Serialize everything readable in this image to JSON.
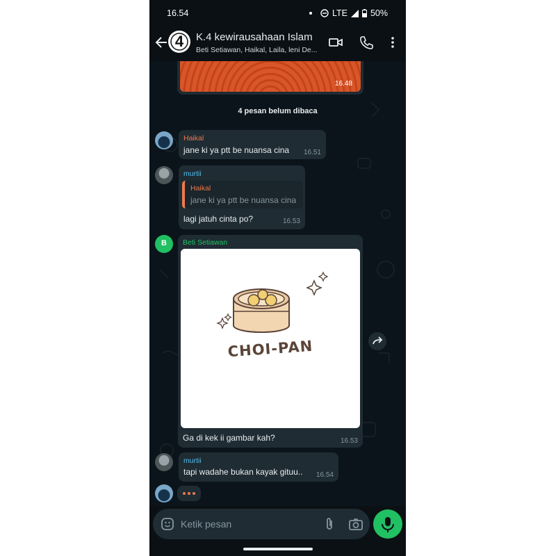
{
  "status_bar": {
    "time": "16.54",
    "network": "LTE",
    "battery": "50%"
  },
  "header": {
    "group_avatar_text": "4",
    "title": "K.4 kewirausahaan Islam",
    "subtitle": "Beti Setiawan, Haikal, Laila, leni De..."
  },
  "chat": {
    "top_image_time": "16.48",
    "unread_banner": "4 pesan belum dibaca",
    "messages": [
      {
        "sender": "Haikal",
        "sender_color": "#f07a4a",
        "text": "jane ki ya ptt be nuansa cina",
        "time": "16.51"
      },
      {
        "sender": "murtii",
        "sender_color": "#53bdeb",
        "quote": {
          "sender": "Haikal",
          "text": "jane ki ya ptt be nuansa cina"
        },
        "text": "lagi jatuh cinta po?",
        "time": "16.53"
      },
      {
        "sender": "Beti Setiawan",
        "sender_color": "#21c063",
        "avatar_letter": "B",
        "image_text": "CHOI-PAN",
        "text": "Ga di kek ii gambar kah?",
        "time": "16.53"
      },
      {
        "sender": "murtii",
        "sender_color": "#53bdeb",
        "text": "tapi wadahe bukan kayak gituu..",
        "time": "16.54"
      }
    ]
  },
  "input": {
    "placeholder": "Ketik pesan"
  },
  "colors": {
    "accent_green": "#21c063",
    "bubble": "#1f2c34",
    "background": "#0b141a"
  }
}
